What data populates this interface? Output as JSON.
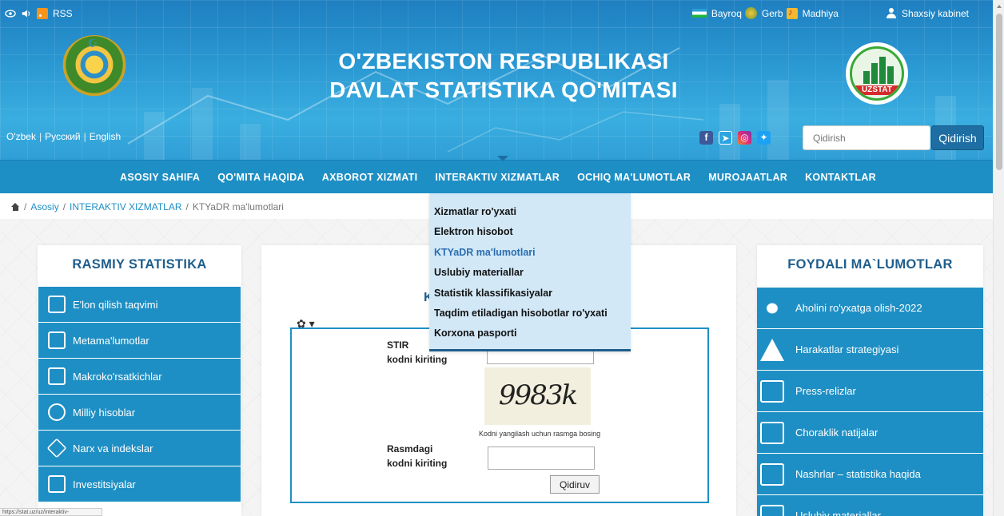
{
  "topbar": {
    "rss_label": "RSS",
    "bayroq": "Bayroq",
    "gerb": "Gerb",
    "madhiya": "Madhiya",
    "cabinet": "Shaxsiy kabinet"
  },
  "header": {
    "title_line1": "O'ZBEKISTON RESPUBLIKASI",
    "title_line2": "DAVLAT STATISTIKA QO'MITASI",
    "logo_text": "UZSTAT"
  },
  "languages": [
    "O'zbek",
    "Русский",
    "English"
  ],
  "search": {
    "placeholder": "Qidirish",
    "button": "Qidirish"
  },
  "nav": [
    "ASOSIY SAHIFA",
    "QO'MITA HAQIDA",
    "AXBOROT XIZMATI",
    "INTERAKTIV XIZMATLAR",
    "OCHIQ MA'LUMOTLAR",
    "MUROJAATLAR",
    "KONTAKTLAR"
  ],
  "breadcrumb": {
    "home": "Asosiy",
    "section": "INTERAKTIV XIZMATLAR",
    "current": "KTYaDR ma'lumotlari"
  },
  "dropdown": [
    "Xizmatlar ro'yxati",
    "Elektron hisobot",
    "KTYaDR ma'lumotlari",
    "Uslubiy materiallar",
    "Statistik klassifikasiyalar",
    "Taqdim etiladigan hisobotlar ro'yxati",
    "Korxona pasporti"
  ],
  "left_panel": {
    "title": "RASMIY STATISTIKA",
    "items": [
      {
        "label": "E'lon qilish taqvimi",
        "icon": "calendar-icon"
      },
      {
        "label": "Metama'lumotlar",
        "icon": "documents-icon"
      },
      {
        "label": "Makroko'rsatkichlar",
        "icon": "chart-icon"
      },
      {
        "label": "Milliy hisoblar",
        "icon": "globe-icon"
      },
      {
        "label": "Narx va indekslar",
        "icon": "tag-icon"
      },
      {
        "label": "Investitsiyalar",
        "icon": "coins-icon"
      }
    ]
  },
  "right_panel": {
    "title": "FOYDALI MA`LUMOTLAR",
    "items": [
      {
        "label": "Aholini ro'yxatga olish-2022",
        "icon": "people-icon"
      },
      {
        "label": "Harakatlar strategiyasi",
        "icon": "monument-icon"
      },
      {
        "label": "Press-relizlar",
        "icon": "newspaper-icon"
      },
      {
        "label": "Choraklik natijalar",
        "icon": "presentation-icon"
      },
      {
        "label": "Nashrlar – statistika haqida",
        "icon": "book-icon"
      },
      {
        "label": "Uslubiy materiallar",
        "icon": "open-book-icon"
      }
    ]
  },
  "form": {
    "title_visible": "K",
    "stir_label_1": "STIR",
    "stir_label_2": "kodni kiriting",
    "captcha_text": "9983k",
    "captcha_hint": "Kodni yangilash uchun rasmga bosing",
    "code_label_1": "Rasmdagi",
    "code_label_2": "kodni kiriting",
    "submit": "Qidiruv"
  },
  "statusbar": {
    "text": "https://stat.uz/uz/interaktiv-xizmatlar/ktyadr"
  }
}
